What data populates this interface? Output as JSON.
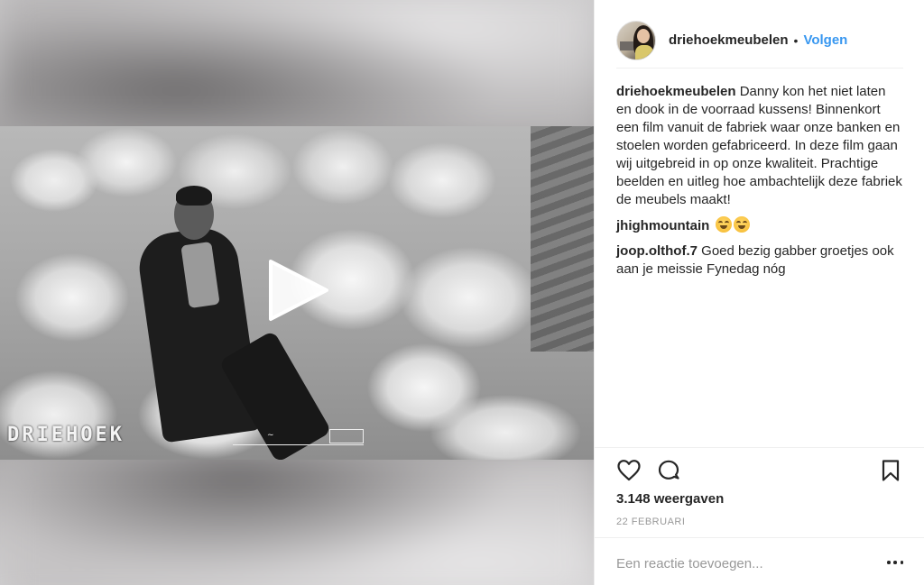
{
  "post": {
    "username": "driehoekmeubelen",
    "dot": "•",
    "follow_label": "Volgen",
    "video": {
      "watermark": "DRIEHOEK",
      "play_icon": "play-icon"
    }
  },
  "comments": [
    {
      "user": "driehoekmeubelen",
      "text": "Danny kon het niet laten en dook in de voorraad kussens! Binnenkort een film vanuit de fabriek waar onze banken en stoelen worden gefabriceerd. In deze film gaan wij uitgebreid in op onze kwaliteit. Prachtige beelden en uitleg hoe ambachtelijk deze fabriek de meubels maakt!"
    },
    {
      "user": "jhighmountain",
      "text": "",
      "emoji": [
        "😂",
        "😂"
      ]
    },
    {
      "user": "joop.olthof.7",
      "text": "Goed bezig gabber groetjes ook aan je meissie Fynedag nóg"
    }
  ],
  "actions": {
    "like_icon": "heart-icon",
    "comment_icon": "comment-icon",
    "save_icon": "bookmark-icon"
  },
  "stats": {
    "views": "3.148 weergaven",
    "date": "22 FEBRUARI"
  },
  "add_comment": {
    "placeholder": "Een reactie toevoegen...",
    "more_icon": "ellipsis-icon"
  },
  "colors": {
    "link_blue": "#3897f0",
    "text": "#262626",
    "muted": "#999999",
    "divider": "#efefef"
  }
}
